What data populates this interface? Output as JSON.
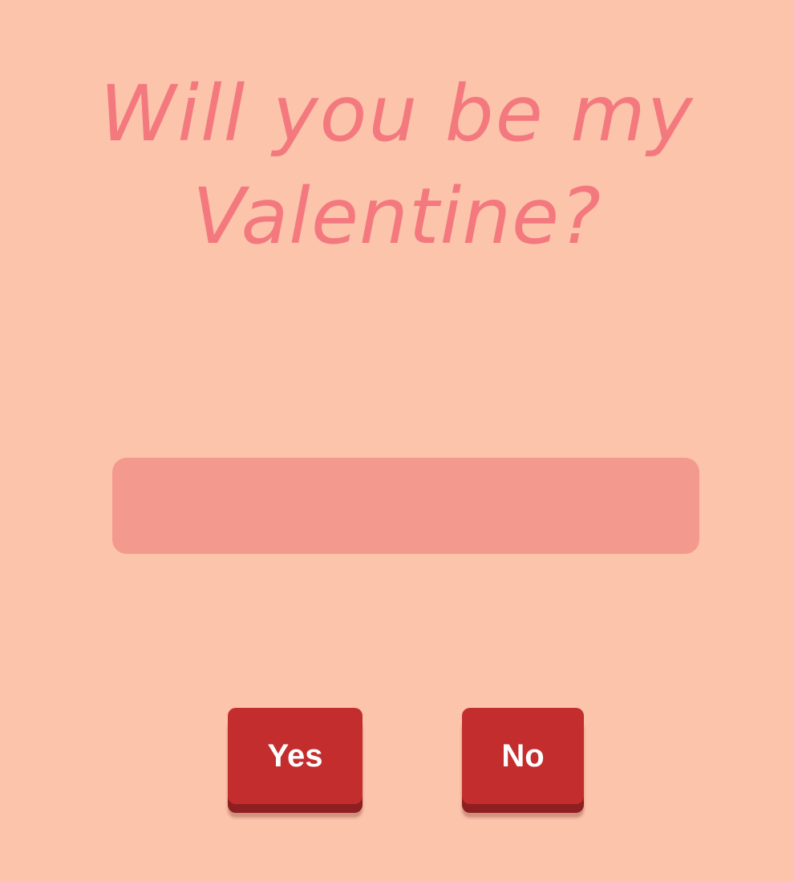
{
  "question": {
    "line1": "Will you be my",
    "line2": "Valentine?"
  },
  "message_box": {
    "text": ""
  },
  "buttons": {
    "yes_label": "Yes",
    "no_label": "No"
  },
  "colors": {
    "background": "#fbc4ab",
    "title": "#f4797f",
    "message_box": "#f4998e",
    "button": "#c42d2e",
    "button_shadow": "#8e1f21",
    "button_text": "#ffffff"
  }
}
